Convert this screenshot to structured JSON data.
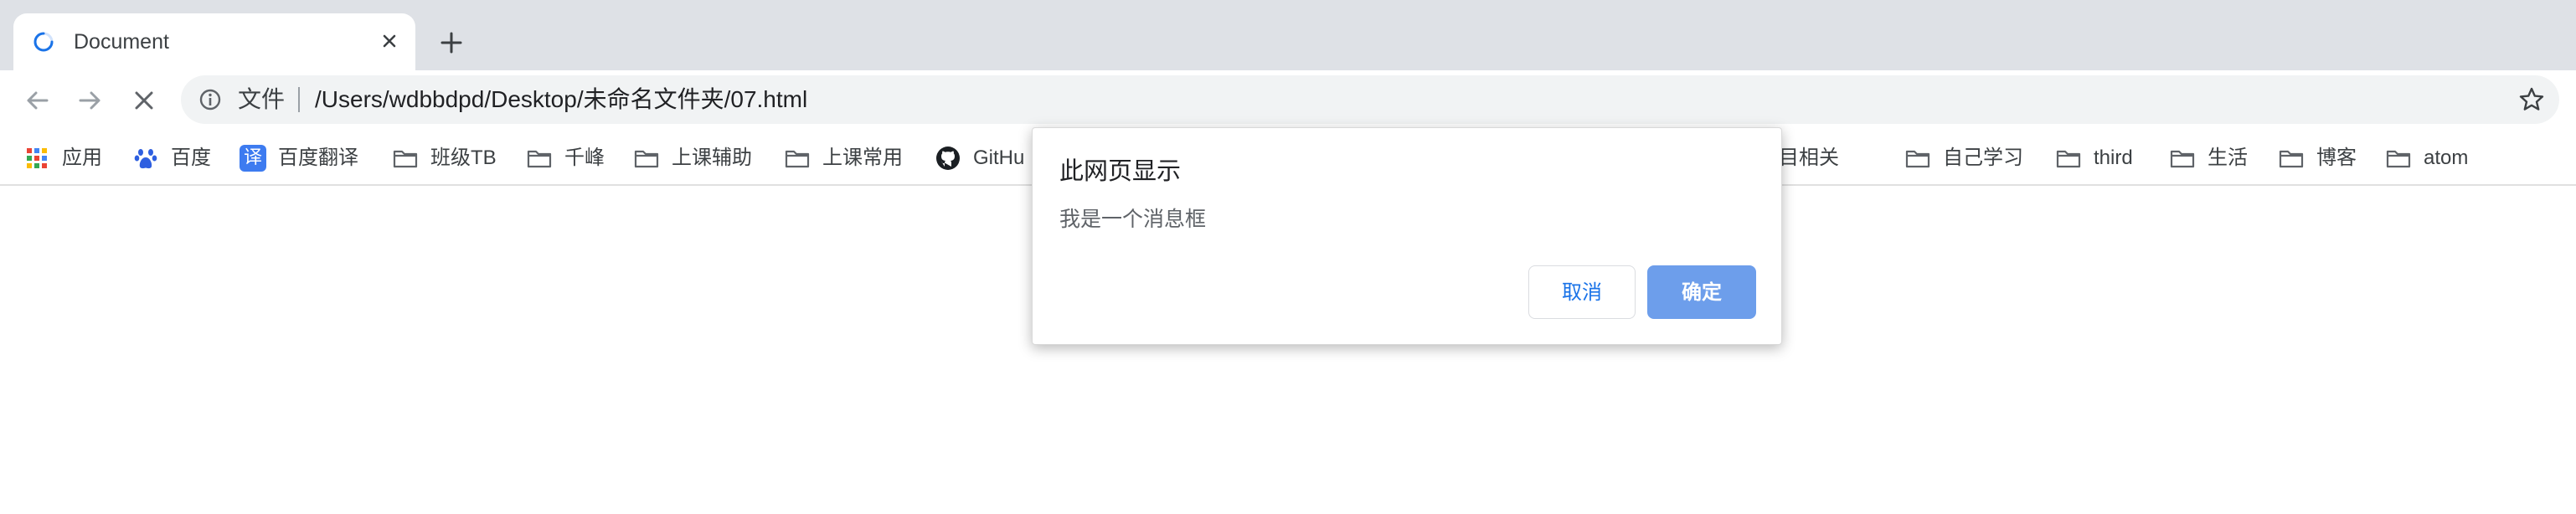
{
  "tab": {
    "title": "Document",
    "icons": {
      "loading": "loading-spinner-icon",
      "close": "close-icon",
      "new_tab": "plus-icon"
    }
  },
  "toolbar": {
    "icons": [
      "back-arrow-icon",
      "forward-arrow-icon",
      "stop-icon",
      "info-icon",
      "star-icon"
    ],
    "scheme_label": "文件",
    "url": "/Users/wdbbdpd/Desktop/未命名文件夹/07.html"
  },
  "bookmarks": {
    "items": [
      {
        "label": "应用",
        "icon": "apps-grid-icon"
      },
      {
        "label": "百度",
        "icon": "baidu-paw-icon"
      },
      {
        "label": "百度翻译",
        "icon": "translate-icon",
        "icon_glyph": "译"
      },
      {
        "label": "班级TB",
        "icon": "folder-icon"
      },
      {
        "label": "千峰",
        "icon": "folder-icon"
      },
      {
        "label": "上课辅助",
        "icon": "folder-icon"
      },
      {
        "label": "上课常用",
        "icon": "folder-icon"
      },
      {
        "label": "GitHu",
        "icon": "github-icon"
      },
      {
        "label": "项目相关",
        "icon": "folder-icon"
      },
      {
        "label": "自己学习",
        "icon": "folder-icon"
      },
      {
        "label": "third",
        "icon": "folder-icon"
      },
      {
        "label": "生活",
        "icon": "folder-icon"
      },
      {
        "label": "博客",
        "icon": "folder-icon"
      },
      {
        "label": "atom",
        "icon": "folder-icon"
      }
    ]
  },
  "dialog": {
    "title": "此网页显示",
    "message": "我是一个消息框",
    "cancel_label": "取消",
    "ok_label": "确定"
  },
  "colors": {
    "tabstrip_bg": "#dee1e6",
    "omnibox_bg": "#f1f3f4",
    "accent_blue": "#1a73e8",
    "ok_button_bg": "#6d9eeb",
    "folder_gray": "#5f6368"
  }
}
